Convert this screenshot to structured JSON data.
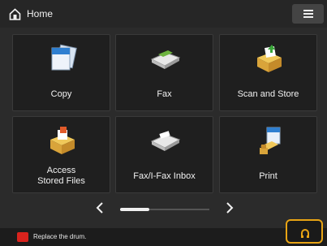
{
  "header": {
    "title": "Home",
    "menu_icon": "hamburger-menu-icon"
  },
  "tiles": [
    {
      "label": "Copy",
      "icon": "copy-icon"
    },
    {
      "label": "Fax",
      "icon": "fax-icon"
    },
    {
      "label": "Scan and Store",
      "icon": "scan-and-store-icon"
    },
    {
      "label": "Access\nStored Files",
      "icon": "access-stored-files-icon"
    },
    {
      "label": "Fax/I-Fax Inbox",
      "icon": "fax-inbox-icon"
    },
    {
      "label": "Print",
      "icon": "print-icon"
    }
  ],
  "pager": {
    "prev_icon": "chevron-left-icon",
    "next_icon": "chevron-right-icon",
    "position": 0.33
  },
  "status": {
    "message": "Replace the drum.",
    "icon": "error-icon",
    "button_icon": "status-monitor-icon"
  },
  "colors": {
    "accent": "#e8a414",
    "error": "#d9231d",
    "background": "#2b2b2b"
  }
}
